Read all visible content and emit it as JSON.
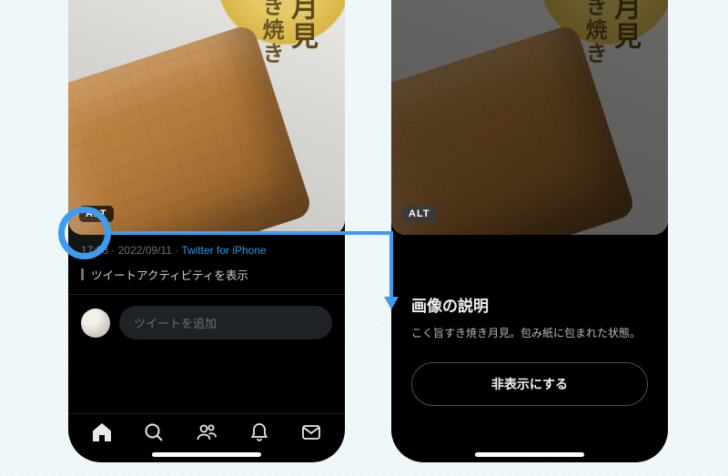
{
  "left": {
    "alt_badge": "ALT",
    "meta_time": "17:03",
    "meta_date": "2022/09/11",
    "meta_source": "Twitter for iPhone",
    "activity_label": "ツイートアクティビティを表示",
    "compose_placeholder": "ツイートを追加",
    "product_label_big": "月見",
    "product_label_small": "き焼き"
  },
  "right": {
    "alt_badge": "ALT",
    "desc_title": "画像の説明",
    "desc_body": "こく旨すき焼き月見。包み紙に包まれた状態。",
    "hide_button": "非表示にする"
  },
  "icons": {
    "home": "home-icon",
    "search": "search-icon",
    "people": "people-icon",
    "notifications": "bell-icon",
    "messages": "mail-icon"
  }
}
